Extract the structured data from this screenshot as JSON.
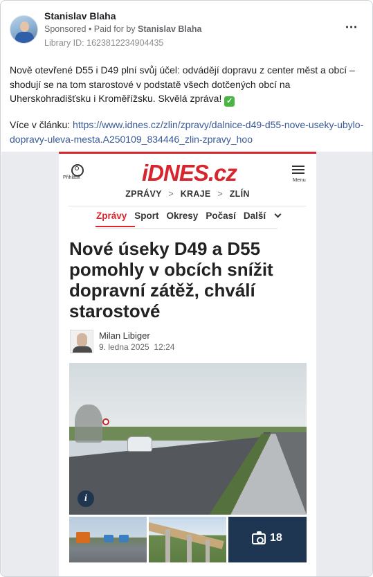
{
  "post": {
    "author": "Stanislav Blaha",
    "sponsored": "Sponsored",
    "paid_for_prefix": " • Paid for by ",
    "paid_for_by": "Stanislav Blaha",
    "library_id": "Library ID: 1623812234904435",
    "more_icon": "⋯",
    "text": "Nově otevřené D55 i D49 plní svůj účel: odvádějí dopravu z center měst a obcí – shodují se na tom starostové v podstatě všech dotčených obcí na Uherskohradišťsku i Kroměřížsku. Skvělá zpráva!",
    "checkmark": "✓",
    "link_prefix": "Více v článku: ",
    "link_url": "https://www.idnes.cz/zlin/zpravy/dalnice-d49-d55-nove-useky-ubylo-dopravy-uleva-mesta.A250109_834446_zlin-zpravy_hoo"
  },
  "article": {
    "brand": "iDNES.cz",
    "login_label": "Přihlásit",
    "menu_label": "Menu",
    "breadcrumbs": [
      "ZPRÁVY",
      "KRAJE",
      "ZLÍN"
    ],
    "breadcrumb_separator": ">",
    "tabs": [
      "Zprávy",
      "Sport",
      "Okresy",
      "Počasí",
      "Další"
    ],
    "active_tab": "Zprávy",
    "headline": "Nové úseky D49 a D55 pomohly v obcích snížit dopravní zátěž, chválí starostové",
    "author_name": "Milan Libiger",
    "date": "9. ledna 2025",
    "time": "12:24",
    "info_icon": "i",
    "photo_count": "18"
  },
  "colors": {
    "brand_red": "#d8262f",
    "link_blue": "#385898",
    "thumb_dark": "#1e3652"
  }
}
